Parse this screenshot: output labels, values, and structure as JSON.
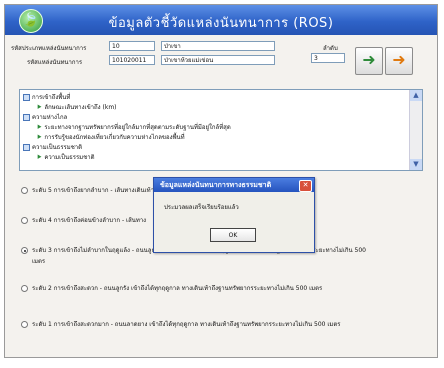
{
  "window": {
    "title": "ข้อมูลตัวชี้วัดแหล่งนันทนาการ (ROS)",
    "app_icon": "🍃"
  },
  "form": {
    "code_label": "รหัสประเภทแหล่งนันทนาการ",
    "code_value": "10",
    "type_value": "ป่าเขา",
    "site_code_label": "รหัสแหล่งนันทนาการ",
    "site_code_value": "101020011",
    "site_name_value": "ป่าเขาห้วยแม่เข่อน",
    "rank_label": "ลำดับ",
    "rank_value": "3"
  },
  "toolbar": {
    "save_icon": "➜",
    "exit_icon": "➜"
  },
  "tree": {
    "items": [
      {
        "label": "การเข้าถึงพื้นที่",
        "kind": "node"
      },
      {
        "label": "ลักษณะเส้นทางเข้าถึง (km)",
        "kind": "leaf"
      },
      {
        "label": "ความห่างไกล",
        "kind": "node"
      },
      {
        "label": "ระยะทางจากฐานทรัพยากรที่อยู่ใกล้มากที่สุดตามระดับฐานที่มีอยู่ใกล้ที่สุด",
        "kind": "leaf"
      },
      {
        "label": "การรับรู้ของนักท่องเที่ยวเกี่ยวกับความห่างไกลของพื้นที่",
        "kind": "leaf"
      },
      {
        "label": "ความเป็นธรรมชาติ",
        "kind": "node"
      },
      {
        "label": "ความเป็นธรรมชาติ",
        "kind": "leaf"
      }
    ]
  },
  "options": [
    {
      "label": "ระดับ 5 การเข้าถึงยากลำบาก - เส้นทางเดินเท้า",
      "checked": false
    },
    {
      "label": "ระดับ 4 การเข้าถึงค่อนข้างลำบาก - เส้นทาง",
      "checked": false
    },
    {
      "label": "ระดับ 3 การเข้าถึงไม่ลำบากในฤดูแล้ง - ถนนลูกรัง เข้าถึงได้สะดวกเฉพาะฤดูแล้ง ทางเดินเท้าถึงฐานทรัพยากรระยะทางไม่เกิน 500",
      "label2": "เมตร",
      "checked": true
    },
    {
      "label": "ระดับ 2 การเข้าถึงสะดวก - ถนนลูกรัง เข้าถึงได้ทุกฤดูกาล ทางเดินเท้าถึงฐานทรัพยากรระยะทางไม่เกิน 500 เมตร",
      "checked": false
    },
    {
      "label": "ระดับ 1 การเข้าถึงสะดวกมาก - ถนนลาดยาง เข้าถึงได้ทุกฤดูกาล ทางเดินเท้าถึงฐานทรัพยากรระยะทางไม่เกิน 500 เมตร",
      "checked": false
    }
  ],
  "dialog": {
    "title": "ข้อมูลแหล่งนันทนาการทางธรรมชาติ",
    "message": "ประมวลผลเสร็จเรียบร้อยแล้ว",
    "ok_label": "OK",
    "close_glyph": "✕"
  }
}
